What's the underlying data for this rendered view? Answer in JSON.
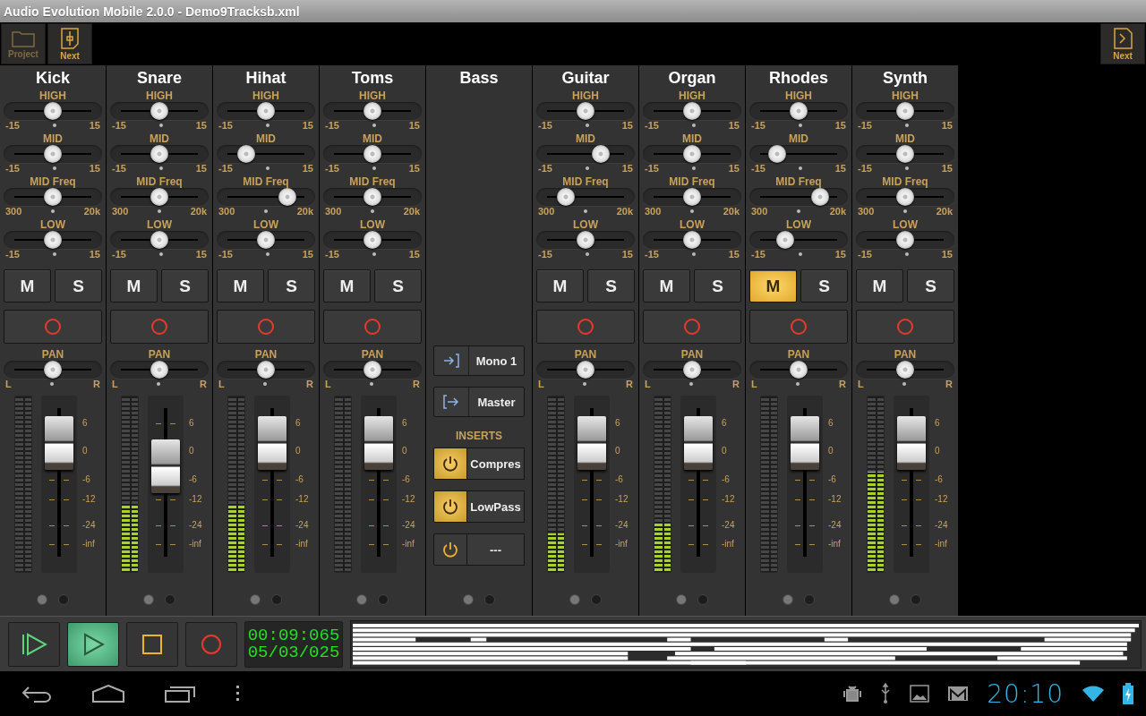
{
  "window": {
    "title": "Audio Evolution Mobile 2.0.0 - Demo9Tracksb.xml"
  },
  "toolbar": {
    "left": [
      {
        "label": "Project",
        "disabled": true
      },
      {
        "label": "Next",
        "disabled": false
      }
    ],
    "right": [
      {
        "label": "Next",
        "disabled": false
      }
    ]
  },
  "channels": [
    {
      "kind": "audio",
      "name": "Kick",
      "eq": [
        {
          "label": "HIGH",
          "min": "-15",
          "max": "15",
          "level": 0.5
        },
        {
          "label": "MID",
          "min": "-15",
          "max": "15",
          "level": 0.5
        },
        {
          "label": "MID Freq",
          "min": "300",
          "max": "20k",
          "level": 0.5
        },
        {
          "label": "LOW",
          "min": "-15",
          "max": "15",
          "level": 0.5
        }
      ],
      "mute": {
        "label": "M",
        "selected": false
      },
      "solo": {
        "label": "S",
        "selected": false
      },
      "pan": {
        "label": "PAN",
        "min": "L",
        "max": "R",
        "level": 0.5
      },
      "meter": {
        "level": 0
      },
      "fader": {
        "level": 0.73,
        "scale": [
          "6",
          "0",
          "-6",
          "-12",
          "-24",
          "-inf"
        ]
      }
    },
    {
      "kind": "audio",
      "name": "Snare",
      "eq": [
        {
          "label": "HIGH",
          "min": "-15",
          "max": "15",
          "level": 0.5
        },
        {
          "label": "MID",
          "min": "-15",
          "max": "15",
          "level": 0.5
        },
        {
          "label": "MID Freq",
          "min": "300",
          "max": "20k",
          "level": 0.5
        },
        {
          "label": "LOW",
          "min": "-15",
          "max": "15",
          "level": 0.5
        }
      ],
      "mute": {
        "label": "M",
        "selected": false
      },
      "solo": {
        "label": "S",
        "selected": false
      },
      "pan": {
        "label": "PAN",
        "min": "L",
        "max": "R",
        "level": 0.5
      },
      "meter": {
        "level": 0.38
      },
      "fader": {
        "level": 0.6,
        "scale": [
          "6",
          "0",
          "-6",
          "-12",
          "-24",
          "-inf"
        ]
      }
    },
    {
      "kind": "audio",
      "name": "Hihat",
      "eq": [
        {
          "label": "HIGH",
          "min": "-15",
          "max": "15",
          "level": 0.5
        },
        {
          "label": "MID",
          "min": "-15",
          "max": "15",
          "level": 0.3
        },
        {
          "label": "MID Freq",
          "min": "300",
          "max": "20k",
          "level": 0.72
        },
        {
          "label": "LOW",
          "min": "-15",
          "max": "15",
          "level": 0.5
        }
      ],
      "mute": {
        "label": "M",
        "selected": false
      },
      "solo": {
        "label": "S",
        "selected": false
      },
      "pan": {
        "label": "PAN",
        "min": "L",
        "max": "R",
        "level": 0.5
      },
      "meter": {
        "level": 0.38
      },
      "fader": {
        "level": 0.73,
        "scale": [
          "6",
          "0",
          "-6",
          "-12",
          "-24",
          "-inf"
        ]
      }
    },
    {
      "kind": "audio",
      "name": "Toms",
      "eq": [
        {
          "label": "HIGH",
          "min": "-15",
          "max": "15",
          "level": 0.5
        },
        {
          "label": "MID",
          "min": "-15",
          "max": "15",
          "level": 0.5
        },
        {
          "label": "MID Freq",
          "min": "300",
          "max": "20k",
          "level": 0.5
        },
        {
          "label": "LOW",
          "min": "-15",
          "max": "15",
          "level": 0.5
        }
      ],
      "mute": {
        "label": "M",
        "selected": false
      },
      "solo": {
        "label": "S",
        "selected": false
      },
      "pan": {
        "label": "PAN",
        "min": "L",
        "max": "R",
        "level": 0.5
      },
      "meter": {
        "level": 0
      },
      "fader": {
        "level": 0.73,
        "scale": [
          "6",
          "0",
          "-6",
          "-12",
          "-24",
          "-inf"
        ]
      }
    },
    {
      "kind": "bus",
      "name": "Bass",
      "routing": [
        {
          "kind": "input",
          "label": "Mono 1"
        },
        {
          "kind": "output",
          "label": "Master"
        }
      ],
      "inserts_label": "INSERTS",
      "inserts": [
        {
          "name": "Compres",
          "on": true
        },
        {
          "name": "LowPass",
          "on": true
        },
        {
          "name": "---",
          "on": false
        }
      ]
    },
    {
      "kind": "audio",
      "name": "Guitar",
      "eq": [
        {
          "label": "HIGH",
          "min": "-15",
          "max": "15",
          "level": 0.5
        },
        {
          "label": "MID",
          "min": "-15",
          "max": "15",
          "level": 0.65
        },
        {
          "label": "MID Freq",
          "min": "300",
          "max": "20k",
          "level": 0.3
        },
        {
          "label": "LOW",
          "min": "-15",
          "max": "15",
          "level": 0.5
        }
      ],
      "mute": {
        "label": "M",
        "selected": false
      },
      "solo": {
        "label": "S",
        "selected": false
      },
      "pan": {
        "label": "PAN",
        "min": "L",
        "max": "R",
        "level": 0.5
      },
      "meter": {
        "level": 0.22
      },
      "fader": {
        "level": 0.73,
        "scale": [
          "6",
          "0",
          "-6",
          "-12",
          "-24",
          "-inf"
        ]
      }
    },
    {
      "kind": "audio",
      "name": "Organ",
      "eq": [
        {
          "label": "HIGH",
          "min": "-15",
          "max": "15",
          "level": 0.5
        },
        {
          "label": "MID",
          "min": "-15",
          "max": "15",
          "level": 0.5
        },
        {
          "label": "MID Freq",
          "min": "300",
          "max": "20k",
          "level": 0.5
        },
        {
          "label": "LOW",
          "min": "-15",
          "max": "15",
          "level": 0.5
        }
      ],
      "mute": {
        "label": "M",
        "selected": false
      },
      "solo": {
        "label": "S",
        "selected": false
      },
      "pan": {
        "label": "PAN",
        "min": "L",
        "max": "R",
        "level": 0.5
      },
      "meter": {
        "level": 0.28
      },
      "fader": {
        "level": 0.73,
        "scale": [
          "6",
          "0",
          "-6",
          "-12",
          "-24",
          "-inf"
        ]
      }
    },
    {
      "kind": "audio",
      "name": "Rhodes",
      "eq": [
        {
          "label": "HIGH",
          "min": "-15",
          "max": "15",
          "level": 0.5
        },
        {
          "label": "MID",
          "min": "-15",
          "max": "15",
          "level": 0.28
        },
        {
          "label": "MID Freq",
          "min": "300",
          "max": "20k",
          "level": 0.72
        },
        {
          "label": "LOW",
          "min": "-15",
          "max": "15",
          "level": 0.36
        }
      ],
      "mute": {
        "label": "M",
        "selected": true
      },
      "solo": {
        "label": "S",
        "selected": false
      },
      "pan": {
        "label": "PAN",
        "min": "L",
        "max": "R",
        "level": 0.5
      },
      "meter": {
        "level": 0
      },
      "fader": {
        "level": 0.73,
        "scale": [
          "6",
          "0",
          "-6",
          "-12",
          "-24",
          "-inf"
        ]
      }
    },
    {
      "kind": "audio",
      "name": "Synth",
      "eq": [
        {
          "label": "HIGH",
          "min": "-15",
          "max": "15",
          "level": 0.5
        },
        {
          "label": "MID",
          "min": "-15",
          "max": "15",
          "level": 0.5
        },
        {
          "label": "MID Freq",
          "min": "300",
          "max": "20k",
          "level": 0.5
        },
        {
          "label": "LOW",
          "min": "-15",
          "max": "15",
          "level": 0.5
        }
      ],
      "mute": {
        "label": "M",
        "selected": false
      },
      "solo": {
        "label": "S",
        "selected": false
      },
      "pan": {
        "label": "PAN",
        "min": "L",
        "max": "R",
        "level": 0.5
      },
      "meter": {
        "level": 0.57
      },
      "fader": {
        "level": 0.73,
        "scale": [
          "6",
          "0",
          "-6",
          "-12",
          "-24",
          "-inf"
        ]
      }
    }
  ],
  "transport": {
    "buttons": [
      {
        "kind": "play-from-start",
        "selected": false
      },
      {
        "kind": "play",
        "selected": true
      },
      {
        "kind": "stop",
        "selected": false
      },
      {
        "kind": "record",
        "selected": false
      }
    ],
    "time": "00:09:065",
    "position": "05/03/025"
  },
  "system_bar": {
    "clock": "20:10"
  }
}
